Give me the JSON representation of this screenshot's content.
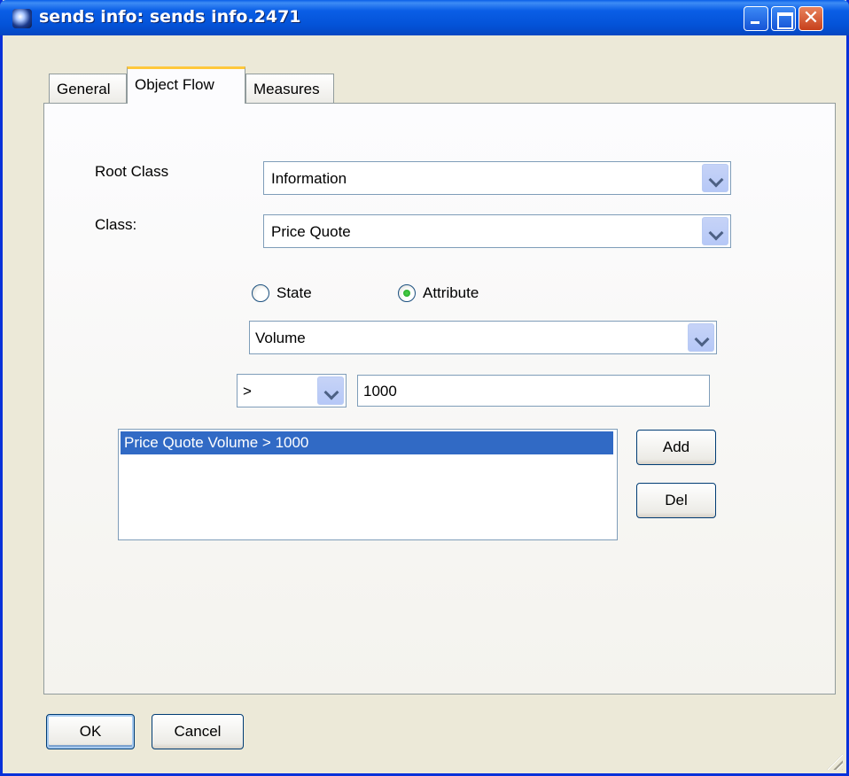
{
  "window": {
    "title": "sends info: sends info.2471"
  },
  "tabs": [
    {
      "label": "General",
      "selected": false
    },
    {
      "label": "Object Flow",
      "selected": true
    },
    {
      "label": "Measures",
      "selected": false
    }
  ],
  "object_flow": {
    "root_class": {
      "label": "Root Class",
      "value": "Information"
    },
    "class": {
      "label": "Class:",
      "value": "Price Quote"
    },
    "mode": {
      "options": [
        {
          "label": "State",
          "checked": false
        },
        {
          "label": "Attribute",
          "checked": true
        }
      ]
    },
    "attribute": {
      "value": "Volume"
    },
    "operator": {
      "value": ">"
    },
    "operand": {
      "value": "1000"
    },
    "conditions": [
      {
        "text": "Price Quote Volume > 1000",
        "selected": true
      }
    ],
    "add_label": "Add",
    "del_label": "Del"
  },
  "footer": {
    "ok_label": "OK",
    "cancel_label": "Cancel"
  },
  "colors": {
    "titlebar": "#0453d8",
    "selection": "#316ac5",
    "dialog_bg": "#ece9d8"
  }
}
